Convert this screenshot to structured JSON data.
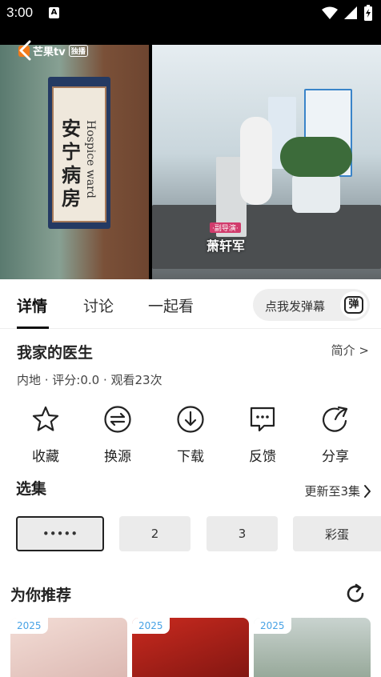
{
  "status_bar": {
    "time": "3:00",
    "notif_letter": "A"
  },
  "video": {
    "watermark_brand": "芒果tv",
    "watermark_tag": "独播",
    "sign_cn": "安宁病房",
    "sign_en": "Hospice ward",
    "caption_tag": "·副导演·",
    "caption_name": "萧轩军"
  },
  "tabs": [
    {
      "label": "详情",
      "active": true
    },
    {
      "label": "讨论",
      "active": false
    },
    {
      "label": "一起看",
      "active": false
    }
  ],
  "danmu": {
    "label": "点我发弹幕",
    "icon_text": "弹"
  },
  "detail": {
    "title": "我家的医生",
    "intro_link": "简介 >",
    "meta": "内地 · 评分:0.0 · 观看23次"
  },
  "actions": [
    {
      "label": "收藏",
      "icon": "star-icon"
    },
    {
      "label": "换源",
      "icon": "switch-source-icon"
    },
    {
      "label": "下载",
      "icon": "download-icon"
    },
    {
      "label": "反馈",
      "icon": "feedback-icon"
    },
    {
      "label": "分享",
      "icon": "share-icon"
    }
  ],
  "episodes": {
    "title": "选集",
    "more": "更新至3集",
    "items": [
      {
        "label": "•••••",
        "selected": true
      },
      {
        "label": "2",
        "selected": false
      },
      {
        "label": "3",
        "selected": false
      },
      {
        "label": "彩蛋",
        "selected": false
      }
    ]
  },
  "recommend": {
    "title": "为你推荐",
    "cards": [
      {
        "year": "2025",
        "color": "#e9c9c4"
      },
      {
        "year": "2025",
        "color": "#b3261e"
      },
      {
        "year": "2025",
        "color": "#9fb0a4"
      }
    ]
  }
}
